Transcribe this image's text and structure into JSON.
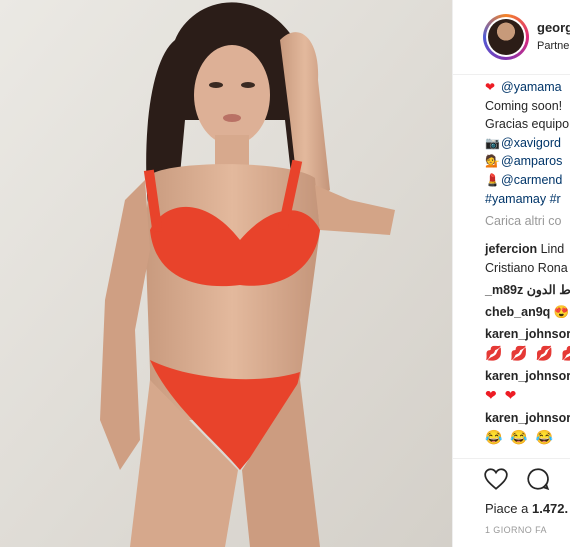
{
  "post": {
    "username": "georg",
    "partner_label": "Partne"
  },
  "caption": {
    "lines": [
      {
        "icon": "heart-icon",
        "text": "@yamama",
        "is_link": true
      },
      {
        "icon": "",
        "text": "Coming soon!",
        "is_link": false
      },
      {
        "icon": "",
        "text": "Gracias equipo",
        "is_link": false
      },
      {
        "icon": "camera-icon",
        "text": "@xavigord",
        "is_link": true
      },
      {
        "icon": "woman-icon",
        "text": "@amparos",
        "is_link": true
      },
      {
        "icon": "lipstick-icon",
        "text": "@carmend",
        "is_link": true
      },
      {
        "icon": "",
        "text": "#yamamay #r",
        "is_link": true
      }
    ]
  },
  "load_more_label": "Carica altri co",
  "comments": [
    {
      "user": "jefercion",
      "text": "Lind",
      "extra_line": "Cristiano Rona"
    },
    {
      "user": "",
      "text": "_m89z ط الدون",
      "extra_line": ""
    },
    {
      "user": "cheb_an9q",
      "text": "😍",
      "extra_line": ""
    },
    {
      "user": "karen_johnsor",
      "text": "",
      "extra_line": "💋 💋 💋 💋"
    },
    {
      "user": "karen_johnsor",
      "text": "",
      "extra_line": "❤ ❤"
    },
    {
      "user": "karen_johnsor",
      "text": "",
      "extra_line": "😂 😂 😂"
    }
  ],
  "likes": {
    "prefix": "Piace a ",
    "count": "1.472."
  },
  "timestamp": "1 GIORNO FA",
  "icons": {
    "like": "heart-outline-icon",
    "comment": "comment-bubble-icon"
  },
  "colors": {
    "swimsuit": "#e8432b",
    "link": "#003569",
    "muted": "#999999",
    "heart": "#ed1c24"
  }
}
